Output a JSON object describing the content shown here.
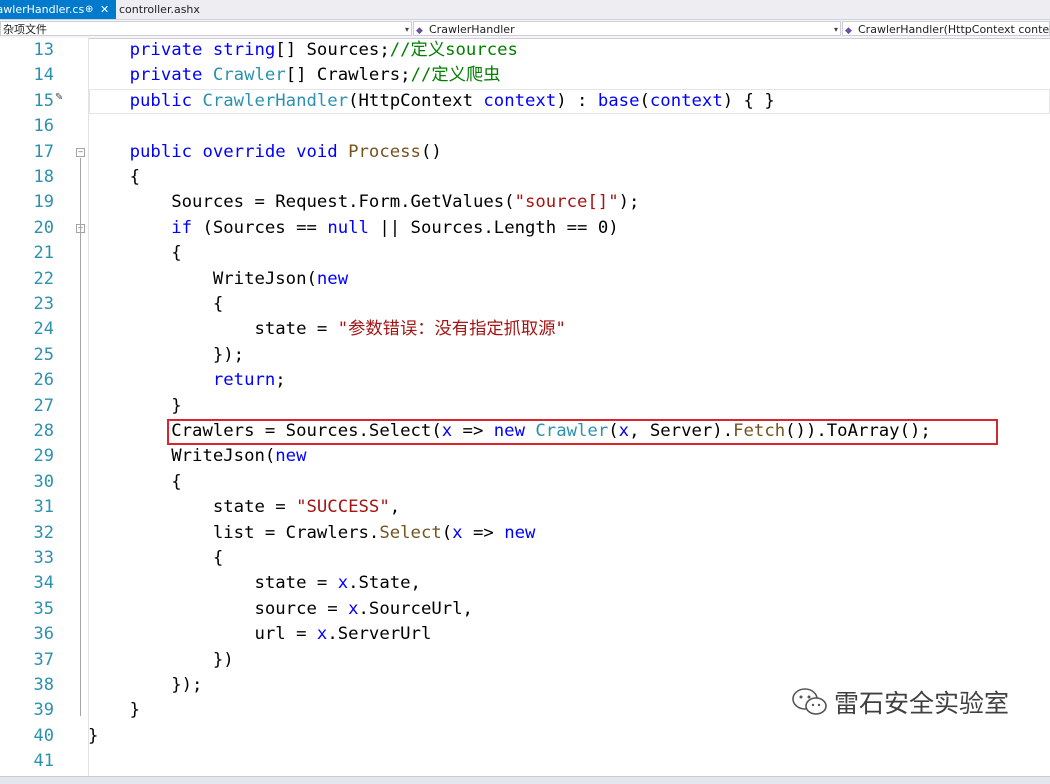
{
  "tabs": [
    {
      "label": "rawlerHandler.cs",
      "pin": "⊕",
      "close": "✕"
    },
    {
      "label": "controller.ashx"
    }
  ],
  "nav": {
    "scope": "杂项文件",
    "class": "CrawlerHandler",
    "member": "CrawlerHandler(HttpContext context)"
  },
  "editor": {
    "line_numbers": [
      "13",
      "14",
      "15",
      "16",
      "17",
      "18",
      "19",
      "20",
      "21",
      "22",
      "23",
      "24",
      "25",
      "26",
      "27",
      "28",
      "29",
      "30",
      "31",
      "32",
      "33",
      "34",
      "35",
      "36",
      "37",
      "38",
      "39",
      "40",
      "41"
    ],
    "lines": [
      [
        {
          "t": "    private ",
          "c": "kw"
        },
        {
          "t": "string",
          "c": "kw"
        },
        {
          "t": "[] Sources;"
        },
        {
          "t": "//定义sources",
          "c": "cm"
        }
      ],
      [
        {
          "t": "    private ",
          "c": "kw"
        },
        {
          "t": "Crawler",
          "c": "ty"
        },
        {
          "t": "[] Crawlers;"
        },
        {
          "t": "//定义爬虫",
          "c": "cm"
        }
      ],
      [
        {
          "t": "    public ",
          "c": "kw"
        },
        {
          "t": "CrawlerHandler",
          "c": "ty"
        },
        {
          "t": "(HttpContext "
        },
        {
          "t": "context",
          "c": "kw"
        },
        {
          "t": ") : "
        },
        {
          "t": "base",
          "c": "kw"
        },
        {
          "t": "("
        },
        {
          "t": "context",
          "c": "kw"
        },
        {
          "t": ") { }"
        }
      ],
      [],
      [
        {
          "t": "    public ",
          "c": "kw"
        },
        {
          "t": "override ",
          "c": "kw"
        },
        {
          "t": "void ",
          "c": "kw"
        },
        {
          "t": "Process",
          "c": "fn"
        },
        {
          "t": "()"
        }
      ],
      [
        {
          "t": "    {"
        }
      ],
      [
        {
          "t": "        Sources = Request.Form.GetValues("
        },
        {
          "t": "\"source[]\"",
          "c": "str"
        },
        {
          "t": ");"
        }
      ],
      [
        {
          "t": "        "
        },
        {
          "t": "if",
          "c": "kw"
        },
        {
          "t": " (Sources == "
        },
        {
          "t": "null",
          "c": "kw"
        },
        {
          "t": " || Sources.Length == 0)"
        }
      ],
      [
        {
          "t": "        {"
        }
      ],
      [
        {
          "t": "            WriteJson("
        },
        {
          "t": "new",
          "c": "kw"
        }
      ],
      [
        {
          "t": "            {"
        }
      ],
      [
        {
          "t": "                state = "
        },
        {
          "t": "\"参数错误：没有指定抓取源\"",
          "c": "str"
        }
      ],
      [
        {
          "t": "            });"
        }
      ],
      [
        {
          "t": "            "
        },
        {
          "t": "return",
          "c": "kw"
        },
        {
          "t": ";"
        }
      ],
      [
        {
          "t": "        }"
        }
      ],
      [
        {
          "t": "        Crawlers = Sources.Select("
        },
        {
          "t": "x",
          "c": "kw"
        },
        {
          "t": " => "
        },
        {
          "t": "new ",
          "c": "kw"
        },
        {
          "t": "Crawler",
          "c": "ty"
        },
        {
          "t": "("
        },
        {
          "t": "x",
          "c": "kw"
        },
        {
          "t": ", Server)."
        },
        {
          "t": "Fetch",
          "c": "fn"
        },
        {
          "t": "()).ToArray();"
        }
      ],
      [
        {
          "t": "        WriteJson("
        },
        {
          "t": "new",
          "c": "kw"
        }
      ],
      [
        {
          "t": "        {"
        }
      ],
      [
        {
          "t": "            state = "
        },
        {
          "t": "\"SUCCESS\"",
          "c": "str"
        },
        {
          "t": ","
        }
      ],
      [
        {
          "t": "            list = Crawlers."
        },
        {
          "t": "Select",
          "c": "fn"
        },
        {
          "t": "("
        },
        {
          "t": "x",
          "c": "kw"
        },
        {
          "t": " => "
        },
        {
          "t": "new",
          "c": "kw"
        }
      ],
      [
        {
          "t": "            {"
        }
      ],
      [
        {
          "t": "                state = "
        },
        {
          "t": "x",
          "c": "kw"
        },
        {
          "t": ".State,"
        }
      ],
      [
        {
          "t": "                source = "
        },
        {
          "t": "x",
          "c": "kw"
        },
        {
          "t": ".SourceUrl,"
        }
      ],
      [
        {
          "t": "                url = "
        },
        {
          "t": "x",
          "c": "kw"
        },
        {
          "t": ".ServerUrl"
        }
      ],
      [
        {
          "t": "            })"
        }
      ],
      [
        {
          "t": "        });"
        }
      ],
      [
        {
          "t": "    }"
        }
      ],
      [
        {
          "t": "}"
        }
      ],
      []
    ]
  },
  "watermark": {
    "text": "雷石安全实验室",
    "icon": "wechat-icon"
  },
  "colors": {
    "keyword": "#0000ff",
    "type": "#2b91af",
    "string": "#a31515",
    "comment": "#008000",
    "method": "#74531f",
    "highlight_box": "#d9262c",
    "active_tab": "#007acc"
  }
}
